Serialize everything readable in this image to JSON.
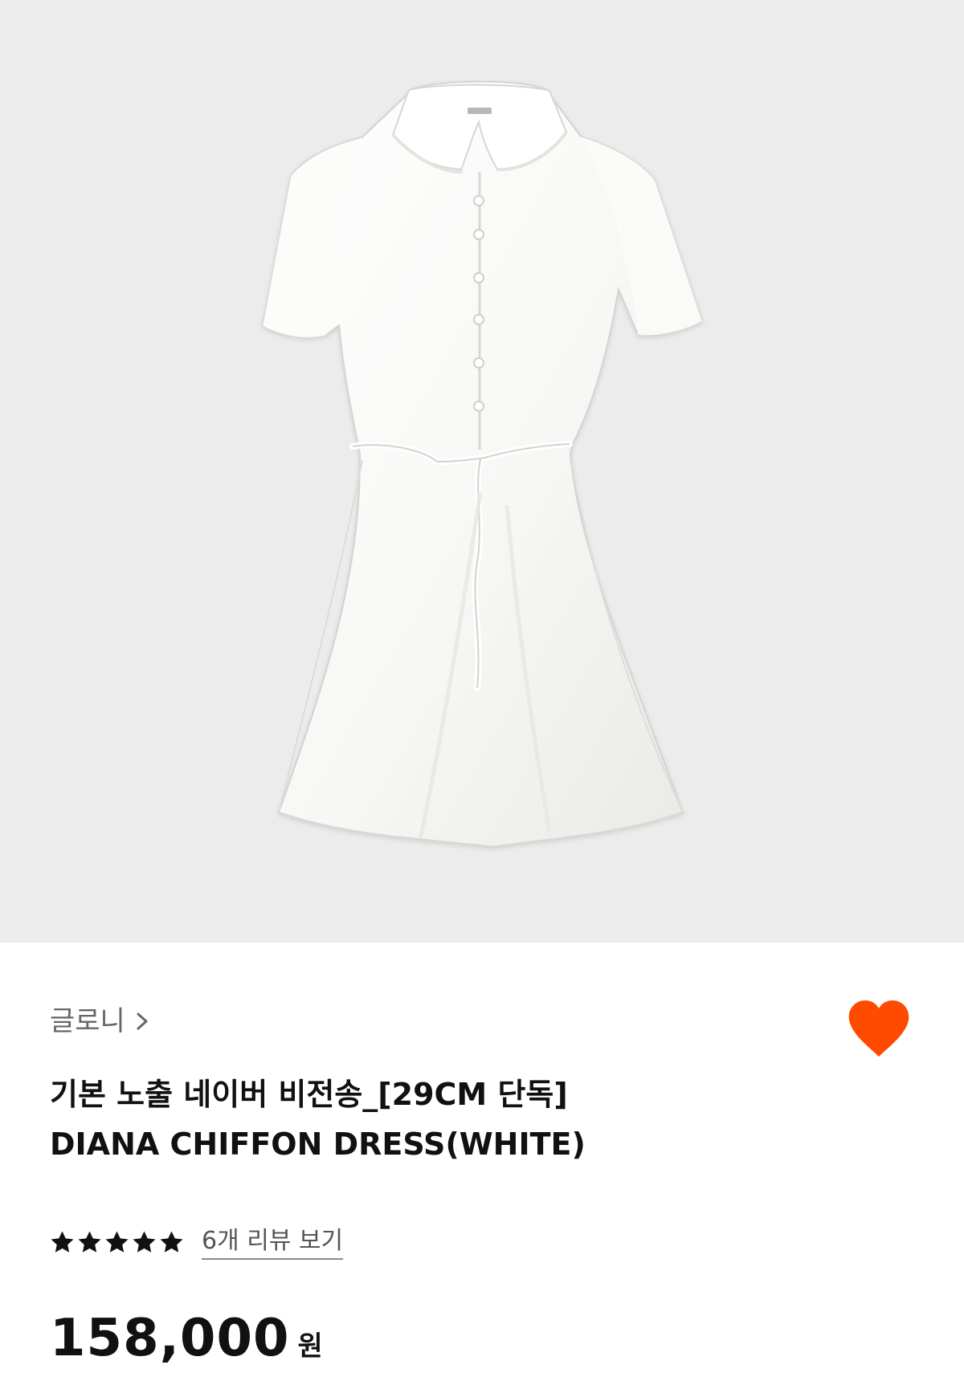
{
  "colors": {
    "hero_background": "#ececec",
    "dress": "#f8f8f6",
    "heart": "#ff4b00",
    "text_primary": "#111111",
    "text_secondary": "#666666"
  },
  "product": {
    "image_subject": "white chiffon dress",
    "brand": "글로니",
    "title_line1": "기본 노출 네이버 비전송_[29CM 단독]",
    "title_line2": "DIANA CHIFFON DRESS(WHITE)",
    "rating": {
      "stars": 5,
      "max_stars": 5
    },
    "review_link": "6개 리뷰 보기",
    "price": "158,000",
    "currency": "원"
  },
  "icons": {
    "brand_chevron": "chevron-right-icon",
    "like": "heart-icon",
    "star": "star-icon"
  }
}
